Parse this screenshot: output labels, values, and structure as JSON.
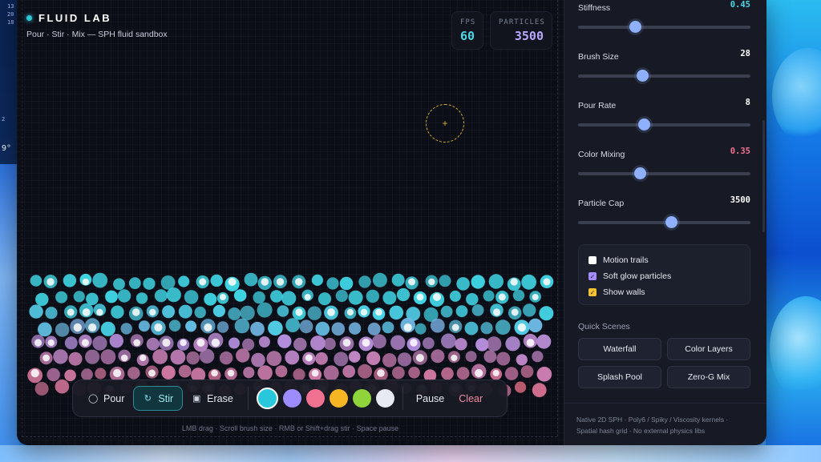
{
  "app": {
    "title": "FLUID LAB",
    "subtitle": "Pour · Stir · Mix — SPH fluid sandbox",
    "accent": "#2ec7d8"
  },
  "stats": [
    {
      "label": "FPS",
      "value": "60",
      "color": "#4fd6e6"
    },
    {
      "label": "PARTICLES",
      "value": "3500",
      "color": "#b9a6ff"
    }
  ],
  "brush_cursor": {
    "icon": "crosshair-icon",
    "glyph": "+"
  },
  "toolbar": {
    "tools": [
      {
        "label": "Pour",
        "icon": "droplet-icon",
        "glyph": "⚲",
        "active": false
      },
      {
        "label": "Stir",
        "icon": "stir-icon",
        "glyph": "↻",
        "active": true
      },
      {
        "label": "Erase",
        "icon": "trash-icon",
        "glyph": "🗑",
        "active": false
      }
    ],
    "swatches": [
      {
        "name": "cyan",
        "color": "#29c7dc",
        "selected": true
      },
      {
        "name": "violet",
        "color": "#9d8cff",
        "selected": false
      },
      {
        "name": "pink",
        "color": "#f07190",
        "selected": false
      },
      {
        "name": "amber",
        "color": "#f6b624",
        "selected": false
      },
      {
        "name": "lime",
        "color": "#8ed43a",
        "selected": false
      },
      {
        "name": "white",
        "color": "#e7e9f3",
        "selected": false
      }
    ],
    "pause_label": "Pause",
    "clear_label": "Clear"
  },
  "hint": "LMB drag · Scroll brush size · RMB or Shift+drag stir · Space pause",
  "sliders": [
    {
      "label": "Stiffness",
      "value": "0.45",
      "fraction": 0.33,
      "value_color": "#4fd6e6"
    },
    {
      "label": "Brush Size",
      "value": "28",
      "fraction": 0.37,
      "value_color": "#ffffff"
    },
    {
      "label": "Pour Rate",
      "value": "8",
      "fraction": 0.38,
      "value_color": "#ffffff"
    },
    {
      "label": "Color Mixing",
      "value": "0.35",
      "fraction": 0.36,
      "value_color": "#f07190"
    },
    {
      "label": "Particle Cap",
      "value": "3500",
      "fraction": 0.54,
      "value_color": "#ffffff"
    }
  ],
  "checkboxes": [
    {
      "label": "Motion trails",
      "checked": false,
      "color": "#ffffff"
    },
    {
      "label": "Soft glow particles",
      "checked": true,
      "color": "#a48bff"
    },
    {
      "label": "Show walls",
      "checked": true,
      "color": "#f6c22f"
    }
  ],
  "quick_scenes": {
    "title": "Quick Scenes",
    "items": [
      "Waterfall",
      "Color Layers",
      "Splash Pool",
      "Zero-G Mix"
    ]
  },
  "footer": {
    "line1": "Native 2D SPH · Poly6 / Spiky / Viscosity kernels ·",
    "line2": "Spatial hash grid · No external physics libs"
  },
  "desktop_left": [
    "13",
    "20",
    "18",
    "2",
    "9°"
  ]
}
